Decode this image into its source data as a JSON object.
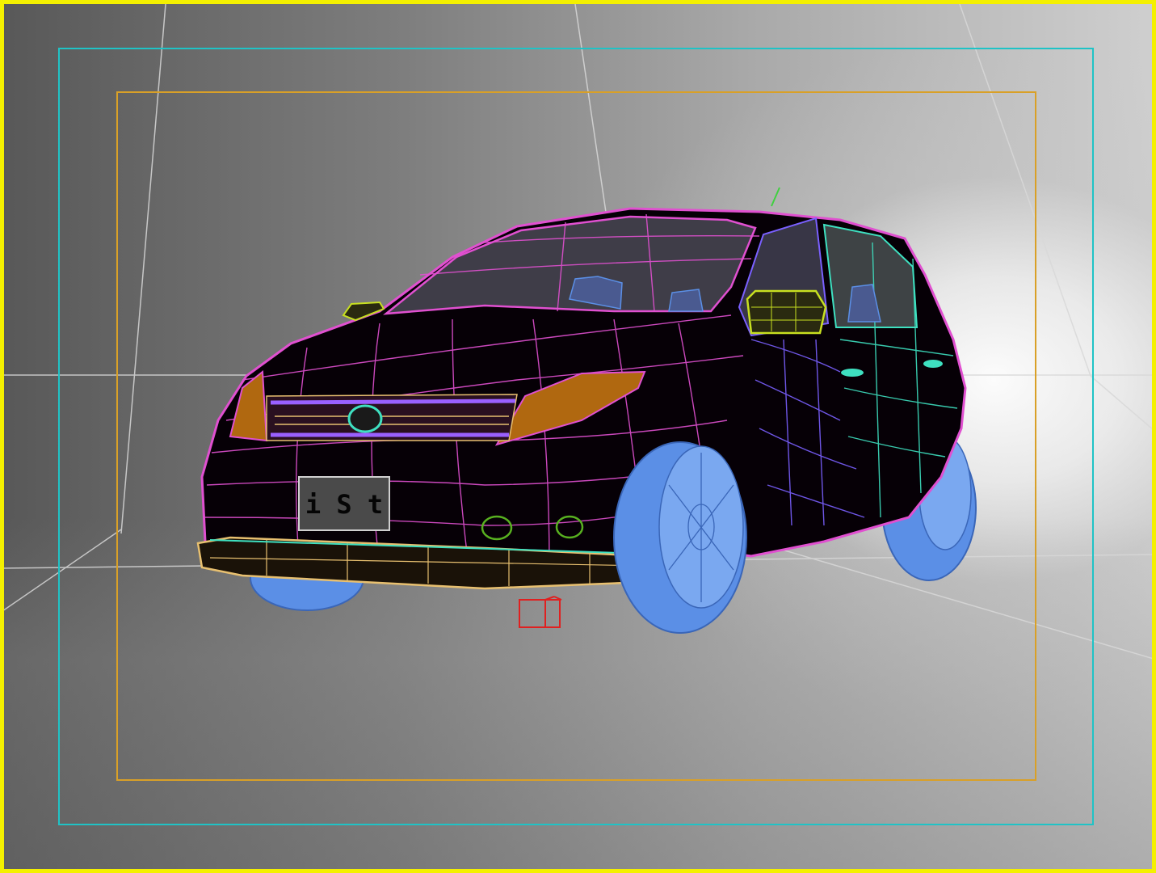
{
  "viewport": {
    "mode": "wireframe-perspective",
    "active": true,
    "colors": {
      "active_border": "#f4f000",
      "safe_frame_outer": "#1fc3c6",
      "safe_frame_inner": "#d9a027",
      "body_wire": "#e050d0",
      "wheel": "#5b8fe6",
      "bumper": "#e8c070",
      "side_wire": "#3ee0c0",
      "mirror": "#c8e020",
      "headlight": "#b06810",
      "grid_line": "#d8d8d8",
      "dummy_helper": "#e02020"
    }
  },
  "car": {
    "license_plate": "i S t"
  }
}
